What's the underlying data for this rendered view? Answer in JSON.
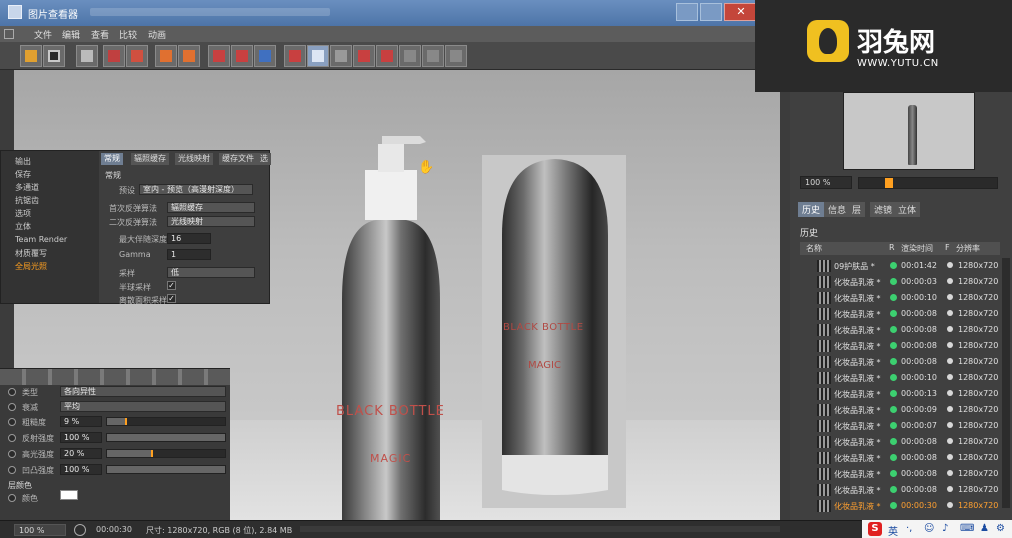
{
  "window": {
    "title": "图片查看器"
  },
  "menu": [
    "文件",
    "编辑",
    "查看",
    "比较",
    "动画"
  ],
  "logo": {
    "name": "羽兔网",
    "url": "WWW.YUTU.CN"
  },
  "navigator": {
    "zoom": "100 %"
  },
  "right_tabs": [
    "历史",
    "信息",
    "层",
    "滤镜",
    "立体"
  ],
  "history": {
    "title": "历史",
    "columns": {
      "name": "名称",
      "r": "R",
      "time": "渲染时间",
      "f": "F",
      "res": "分辨率"
    },
    "rows": [
      {
        "name": "09护肤品 *",
        "time": "00:01:42",
        "res": "1280x720"
      },
      {
        "name": "化妆品乳液 *",
        "time": "00:00:03",
        "res": "1280x720"
      },
      {
        "name": "化妆品乳液 *",
        "time": "00:00:10",
        "res": "1280x720"
      },
      {
        "name": "化妆品乳液 *",
        "time": "00:00:08",
        "res": "1280x720"
      },
      {
        "name": "化妆品乳液 *",
        "time": "00:00:08",
        "res": "1280x720"
      },
      {
        "name": "化妆品乳液 *",
        "time": "00:00:08",
        "res": "1280x720"
      },
      {
        "name": "化妆品乳液 *",
        "time": "00:00:08",
        "res": "1280x720"
      },
      {
        "name": "化妆品乳液 *",
        "time": "00:00:10",
        "res": "1280x720"
      },
      {
        "name": "化妆品乳液 *",
        "time": "00:00:13",
        "res": "1280x720"
      },
      {
        "name": "化妆品乳液 *",
        "time": "00:00:09",
        "res": "1280x720"
      },
      {
        "name": "化妆品乳液 *",
        "time": "00:00:07",
        "res": "1280x720"
      },
      {
        "name": "化妆品乳液 *",
        "time": "00:00:08",
        "res": "1280x720"
      },
      {
        "name": "化妆品乳液 *",
        "time": "00:00:08",
        "res": "1280x720"
      },
      {
        "name": "化妆品乳液 *",
        "time": "00:00:08",
        "res": "1280x720"
      },
      {
        "name": "化妆品乳液 *",
        "time": "00:00:08",
        "res": "1280x720"
      },
      {
        "name": "化妆品乳液 *",
        "time": "00:00:30",
        "res": "1280x720"
      }
    ]
  },
  "render_settings": {
    "sidebar": [
      "输出",
      "保存",
      "多通道",
      "抗锯齿",
      "选项",
      "立体",
      "Team Render",
      "材质覆写",
      "全局光照"
    ],
    "tabs": [
      "常规",
      "辐照缓存",
      "光线映射",
      "缓存文件",
      "选"
    ],
    "section": "常规",
    "preset_label": "预设",
    "preset_value": "室内 - 预览（高漫射深度）",
    "primary_label": "首次反弹算法",
    "primary_value": "辐照缓存",
    "secondary_label": "二次反弹算法",
    "secondary_value": "光线映射",
    "depth_label": "最大伴随深度",
    "depth_value": "16",
    "gamma_label": "Gamma",
    "gamma_value": "1",
    "sample_label": "采样",
    "sample_value": "低",
    "hemi_label": "半球采样",
    "discrete_label": "离散面积采样"
  },
  "material": {
    "type_label": "类型",
    "type_value": "各向异性",
    "atten_label": "衰减",
    "atten_value": "平均",
    "rows": [
      {
        "label": "粗糙度",
        "value": "9 %"
      },
      {
        "label": "反射强度",
        "value": "100 %"
      },
      {
        "label": "高光强度",
        "value": "20 %"
      },
      {
        "label": "凹凸强度",
        "value": "100 %"
      }
    ],
    "layer_color_label": "层颜色",
    "color_label": "颜色",
    "color_hex": "#ffffff"
  },
  "product": {
    "brand": "BLACK BOTTLE",
    "sub": "MAGIC",
    "accent": "#c0504a"
  },
  "status": {
    "zoom": "100 %",
    "time": "00:00:30",
    "info": "尺寸: 1280x720, RGB (8 位), 2.84 MB"
  },
  "ime": {
    "label": "英"
  }
}
